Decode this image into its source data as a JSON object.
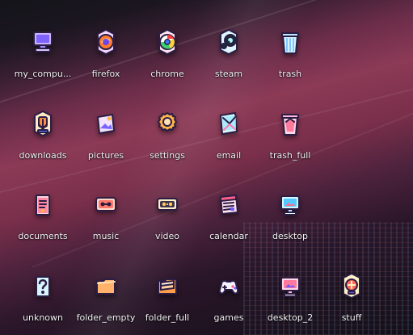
{
  "desktop": {
    "icons": [
      {
        "label": "my_compu..."
      },
      {
        "label": "firefox"
      },
      {
        "label": "chrome"
      },
      {
        "label": "steam"
      },
      {
        "label": "trash"
      },
      {
        "label": "downloads"
      },
      {
        "label": "pictures"
      },
      {
        "label": "settings"
      },
      {
        "label": "email"
      },
      {
        "label": "trash_full"
      },
      {
        "label": "documents"
      },
      {
        "label": "music"
      },
      {
        "label": "video"
      },
      {
        "label": "calendar"
      },
      {
        "label": "desktop"
      },
      {
        "label": "unknown"
      },
      {
        "label": "folder_empty"
      },
      {
        "label": "folder_full"
      },
      {
        "label": "games"
      },
      {
        "label": "desktop_2"
      },
      {
        "label": "stuff"
      }
    ]
  }
}
